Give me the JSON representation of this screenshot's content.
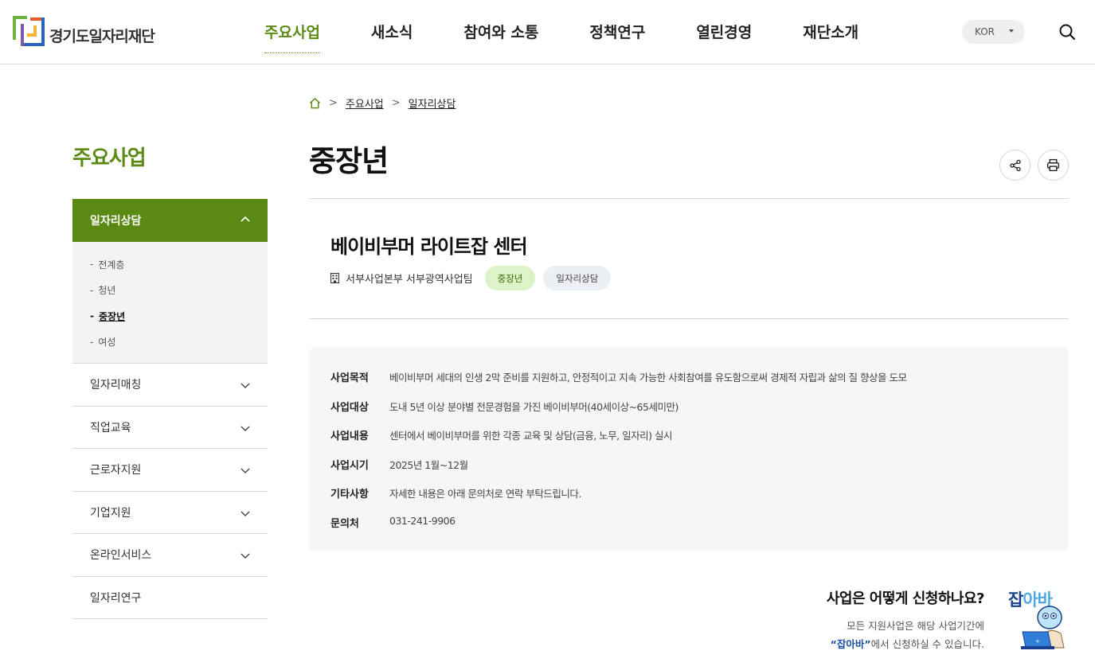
{
  "header": {
    "logo_text": "경기도일자리재단",
    "nav": [
      "주요사업",
      "새소식",
      "참여와 소통",
      "정책연구",
      "열린경영",
      "재단소개"
    ],
    "active_nav": "주요사업",
    "lang": "KOR",
    "search_icon": "search-icon"
  },
  "sidebar": {
    "title": "주요사업",
    "open_section": "일자리상담",
    "sub_items": [
      "전계층",
      "청년",
      "중장년",
      "여성"
    ],
    "active_sub": "중장년",
    "items": [
      "일자리매칭",
      "직업교육",
      "근로자지원",
      "기업지원",
      "온라인서비스",
      "일자리연구"
    ]
  },
  "breadcrumb": {
    "home_icon": "home-icon",
    "items": [
      "주요사업",
      "일자리상담"
    ]
  },
  "page": {
    "title": "중장년",
    "share_icon": "share-icon",
    "print_icon": "print-icon"
  },
  "center": {
    "name": "베이비부머 라이트잡 센터",
    "org": "서부사업본부 서부광역사업팀",
    "tags": [
      "중장년",
      "일자리상담"
    ]
  },
  "info": [
    {
      "label": "사업목적",
      "value": "베이비부머 세대의 인생 2막 준비를 지원하고, 안정적이고 지속 가능한 사회참여를 유도함으로써 경제적 자립과 삶의 질 향상을 도모"
    },
    {
      "label": "사업대상",
      "value": "도내 5년 이상 분야별 전문경험을 가진 베이비부머(40세이상~65세미만)"
    },
    {
      "label": "사업내용",
      "value": "센터에서 베이비부머를 위한 각종 교육 및 상담(금융, 노무, 일자리) 실시"
    },
    {
      "label": "사업시기",
      "value": "2025년 1월~12월"
    },
    {
      "label": "기타사항",
      "value": "자세한 내용은 아래 문의처로 연락 부탁드립니다."
    },
    {
      "label": "문의처",
      "value": "031-241-9906"
    }
  ],
  "apply": {
    "question": "사업은 어떻게 신청하나요?",
    "desc1": "모든 지원사업은 해당 사업기간에",
    "desc2_highlight": "“잡아바”",
    "desc2_rest": "에서 신청하실 수 있습니다.",
    "logo_part1": "잡",
    "logo_part2": "아바"
  }
}
